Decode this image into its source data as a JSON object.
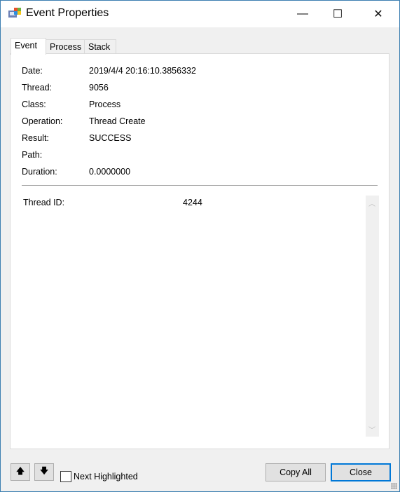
{
  "window": {
    "title": "Event Properties",
    "icon": "procmon-app-icon",
    "minimize": "—",
    "maximize": "☐",
    "close": "✕"
  },
  "tabs": [
    {
      "label": "Event",
      "active": true
    },
    {
      "label": "Process"
    },
    {
      "label": "Stack"
    }
  ],
  "fields": [
    {
      "label": "Date:",
      "value": "2019/4/4 20:16:10.3856332"
    },
    {
      "label": "Thread:",
      "value": "9056"
    },
    {
      "label": "Class:",
      "value": "Process"
    },
    {
      "label": "Operation:",
      "value": "Thread Create"
    },
    {
      "label": "Result:",
      "value": "SUCCESS"
    },
    {
      "label": "Path:",
      "value": ""
    },
    {
      "label": "Duration:",
      "value": "0.0000000"
    }
  ],
  "details": [
    {
      "label": "Thread ID:",
      "value": "4244"
    }
  ],
  "footer": {
    "up": "🡅",
    "down": "🡇",
    "next_highlighted": "Next Highlighted",
    "next_highlighted_checked": false,
    "copy_all": "Copy All",
    "close": "Close"
  }
}
